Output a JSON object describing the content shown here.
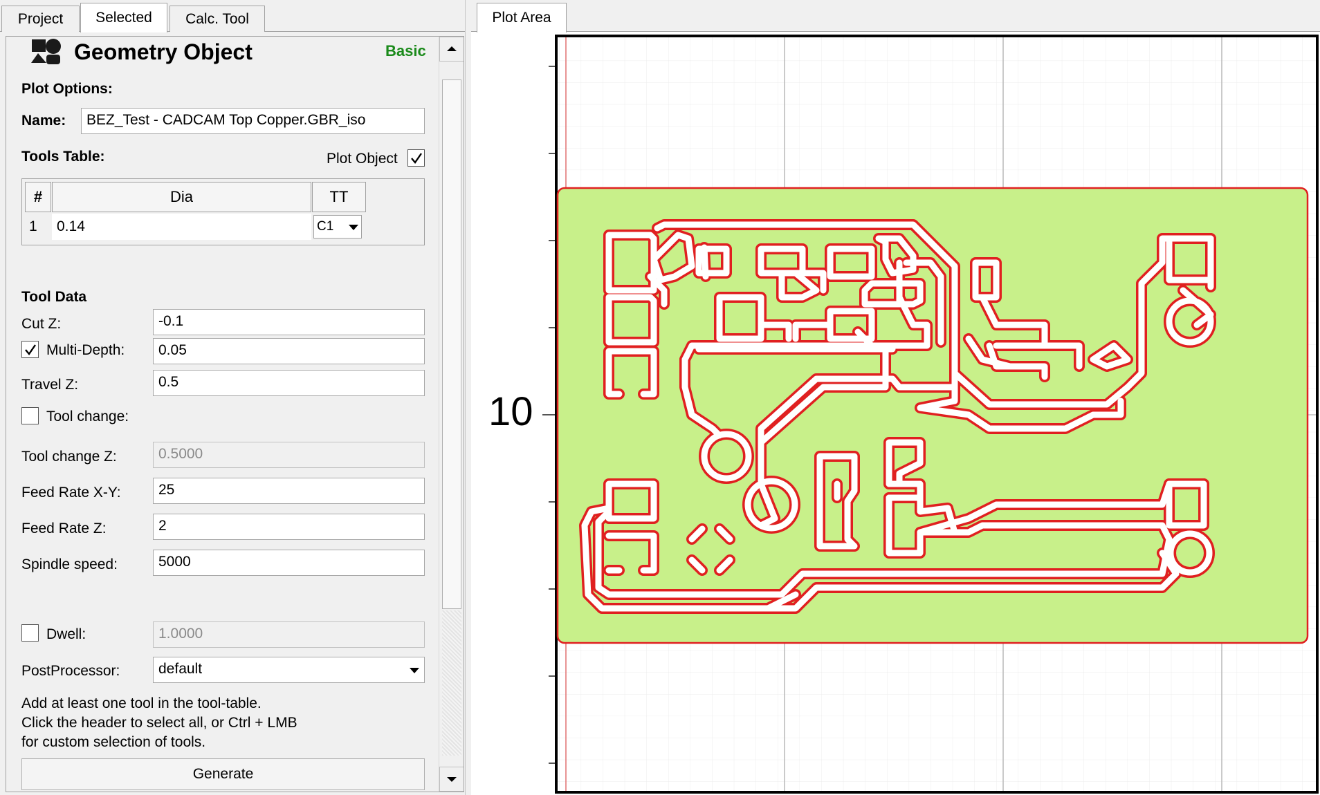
{
  "tabs": {
    "left": [
      {
        "label": "Project",
        "active": false
      },
      {
        "label": "Selected",
        "active": true
      },
      {
        "label": "Calc. Tool",
        "active": false
      }
    ],
    "right": [
      {
        "label": "Plot Area",
        "active": true
      }
    ]
  },
  "header": {
    "title": "Geometry Object",
    "mode": "Basic",
    "mode_color": "#1a8a1a",
    "icon": "geometry-object-icon"
  },
  "plot_options": {
    "heading": "Plot Options:",
    "name_label": "Name:",
    "name_value": "BEZ_Test - CADCAM Top Copper.GBR_iso",
    "tools_table_label": "Tools Table:",
    "plot_object_label": "Plot Object",
    "plot_object_checked": true
  },
  "tools_table": {
    "headers": [
      "#",
      "Dia",
      "TT"
    ],
    "rows": [
      {
        "num": "1",
        "dia": "0.14",
        "tt": "C1"
      }
    ]
  },
  "tool_data": {
    "heading": "Tool Data",
    "cut_z_label": "Cut Z:",
    "cut_z": "-0.1",
    "multi_depth_label": "Multi-Depth:",
    "multi_depth_checked": true,
    "multi_depth": "0.05",
    "travel_z_label": "Travel Z:",
    "travel_z": "0.5",
    "tool_change_label": "Tool change:",
    "tool_change_checked": false,
    "tool_change_z_label": "Tool change Z:",
    "tool_change_z": "0.5000",
    "feed_xy_label": "Feed Rate X-Y:",
    "feed_xy": "25",
    "feed_z_label": "Feed Rate Z:",
    "feed_z": "2",
    "spindle_label": "Spindle speed:",
    "spindle": "5000",
    "dwell_label": "Dwell:",
    "dwell_checked": false,
    "dwell": "1.0000",
    "postprocessor_label": "PostProcessor:",
    "postprocessor": "default"
  },
  "help": {
    "line1": "Add at least one tool in the tool-table.",
    "line2": "Click the header to select all, or Ctrl + LMB",
    "line3": "for custom selection of tools."
  },
  "generate_label": "Generate",
  "plot": {
    "axis_label": "10",
    "board_fill": "#c8f08a",
    "trace_color": "#e02020",
    "grid_color": "#d0d0d0"
  }
}
